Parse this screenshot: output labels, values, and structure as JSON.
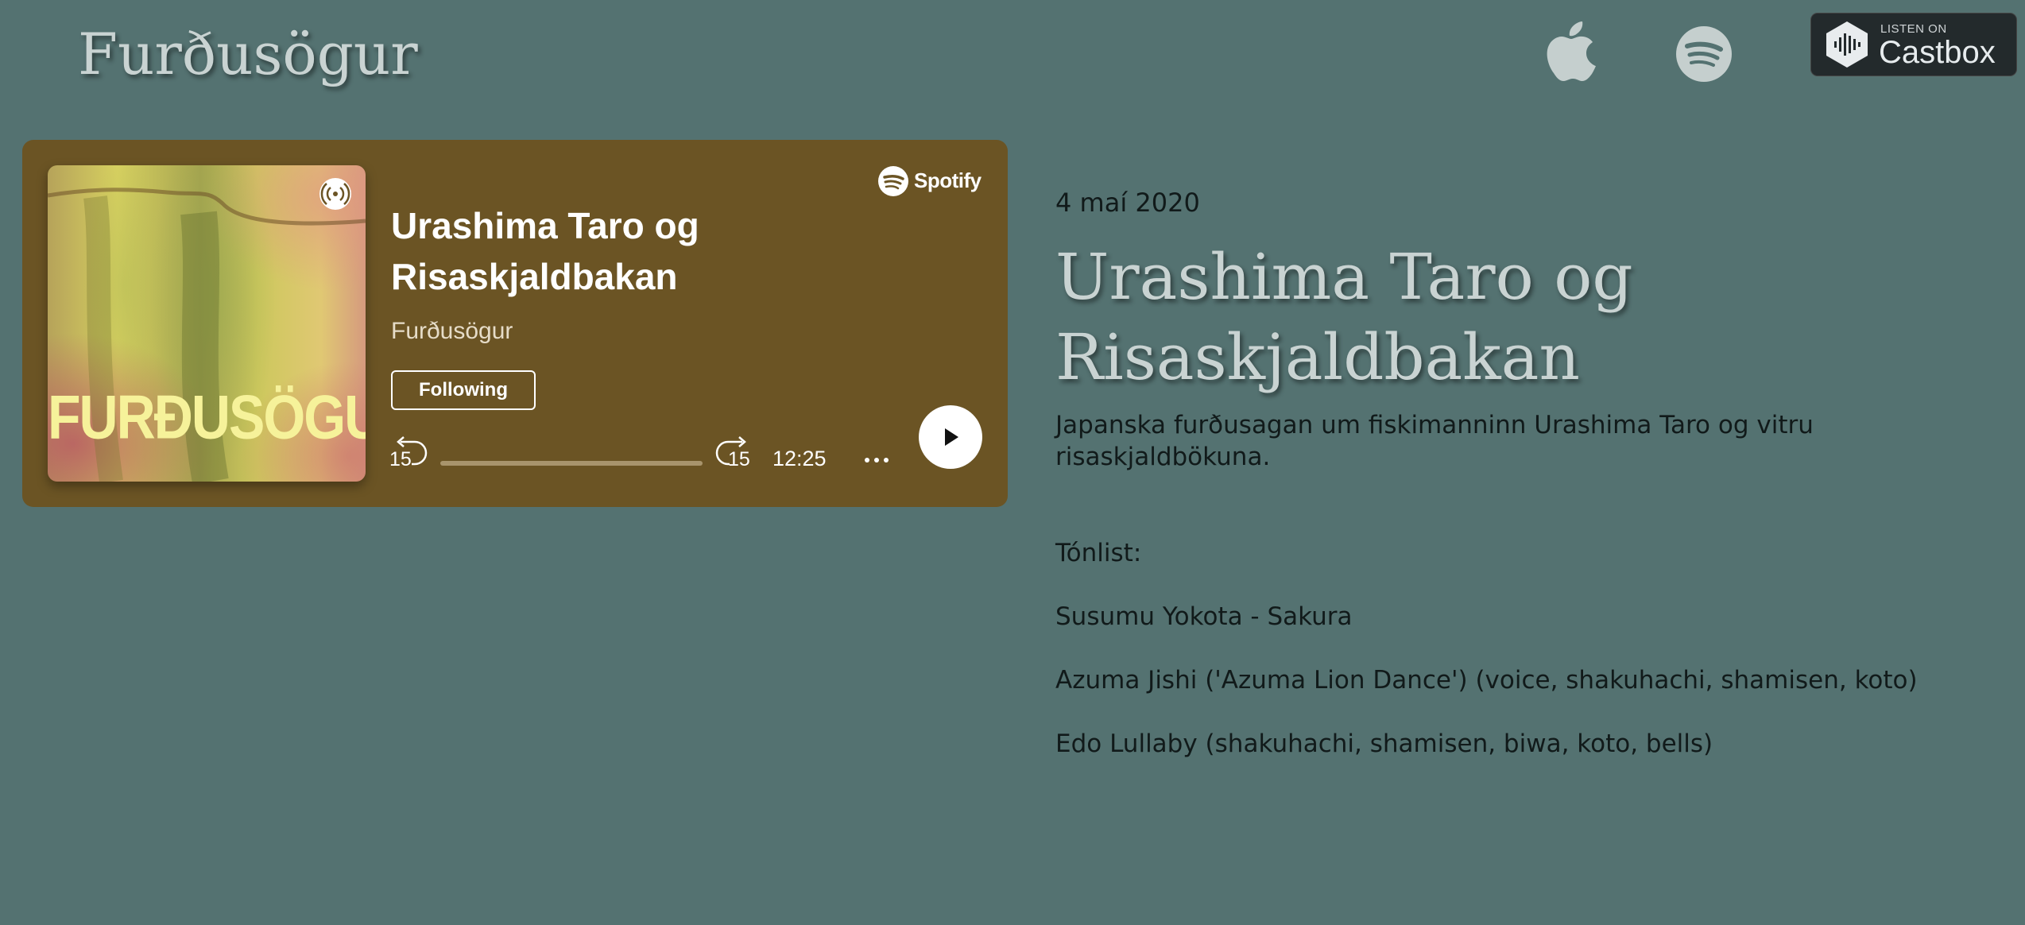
{
  "site": {
    "title": "Furðusögur"
  },
  "header_links": {
    "apple_icon": "apple-podcasts-icon",
    "spotify_icon": "spotify-icon",
    "castbox": {
      "small_label": "LISTEN ON",
      "brand": "Castbox"
    }
  },
  "player": {
    "episode_title": "Urashima Taro og Risaskjaldbakan",
    "show_name": "Furðusögur",
    "follow_label": "Following",
    "brand": "Spotify",
    "cover_text": "FURÐUSÖGUR",
    "skip_back_label": "15",
    "skip_forward_label": "15",
    "duration": "12:25",
    "progress": 0,
    "colors": {
      "card_background": "#6b5424",
      "accent_text": "#ffffff"
    }
  },
  "article": {
    "date": "4 maí 2020",
    "title": "Urashima Taro og Risaskjaldbakan",
    "description": "Japanska furðusagan um fiskimanninn Urashima Taro og vitru risaskjaldbökuna.",
    "music_heading": "Tónlist:",
    "tracks": [
      "Susumu Yokota - Sakura",
      "Azuma Jishi ('Azuma Lion Dance') (voice, shakuhachi, shamisen, koto)",
      "Edo Lullaby (shakuhachi, shamisen, biwa, koto, bells)"
    ]
  },
  "colors": {
    "page_background": "#547271",
    "title_text": "#c9d3d2",
    "body_text": "#111a1a"
  }
}
